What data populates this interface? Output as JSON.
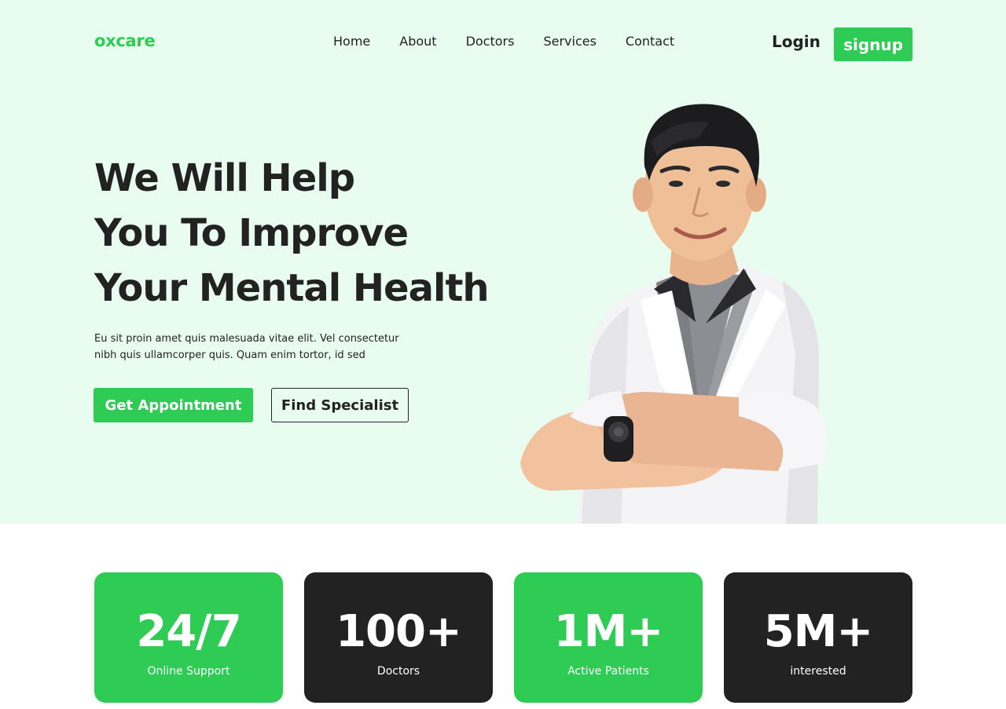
{
  "brand": {
    "logo": "oxcare",
    "accent_color": "#2ecc55",
    "dark_color": "#222222",
    "hero_background": "#e8fdef"
  },
  "nav": {
    "links": [
      "Home",
      "About",
      "Doctors",
      "Services",
      "Contact"
    ],
    "login_label": "Login",
    "signup_label": "signup"
  },
  "hero": {
    "headline_lines": [
      "We Will Help",
      "You To Improve",
      "Your Mental Health"
    ],
    "description": "Eu sit proin amet quis malesuada vitae elit. Vel consectetur nibh quis ullamcorper quis. Quam enim tortor, id sed",
    "primary_button": "Get Appointment",
    "secondary_button": "Find Specialist",
    "image": "smiling-doctor-in-white-coat-arms-crossed"
  },
  "stats": [
    {
      "value": "24/7",
      "label": "Online Support",
      "theme": "green"
    },
    {
      "value": "100+",
      "label": "Doctors",
      "theme": "dark"
    },
    {
      "value": "1M+",
      "label": "Active Patients",
      "theme": "green"
    },
    {
      "value": "5M+",
      "label": "interested",
      "theme": "dark"
    }
  ]
}
